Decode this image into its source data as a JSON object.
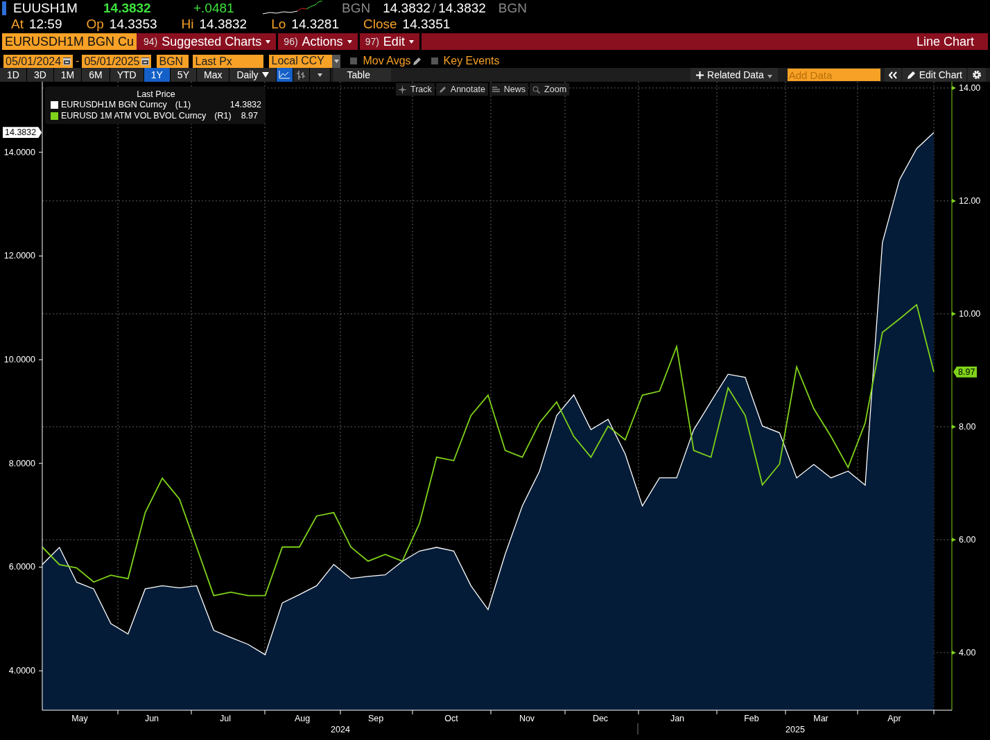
{
  "quote": {
    "ticker": "EUUSH1M",
    "last": "14.3832",
    "change": "+.0481",
    "source": "BGN",
    "bid": "14.3832",
    "separator": "/",
    "ask": "14.3832",
    "source_2": "BGN"
  },
  "stats": [
    {
      "label": "At",
      "value": "12:59"
    },
    {
      "label": "Op",
      "value": "14.3353"
    },
    {
      "label": "Hi",
      "value": "14.3832"
    },
    {
      "label": "Lo",
      "value": "14.3281"
    },
    {
      "label": "Close",
      "value": "14.3351"
    }
  ],
  "menu_bar": {
    "security": "EURUSDH1M BGN Cu",
    "items": [
      {
        "number": "94)",
        "label": "Suggested Charts"
      },
      {
        "number": "96)",
        "label": "Actions"
      },
      {
        "number": "97)",
        "label": "Edit"
      }
    ],
    "chart_type": "Line Chart"
  },
  "settings": {
    "start_date": "05/01/2024",
    "separator": "-",
    "end_date": "05/01/2025",
    "source": "BGN",
    "field": "Last Px",
    "currency": "Local CCY",
    "checkboxes": [
      {
        "label": "Mov Avgs",
        "checked": false,
        "kind": "editable"
      },
      {
        "label": "Key Events",
        "checked": false,
        "kind": "plain"
      }
    ]
  },
  "toolbar": {
    "periods": [
      {
        "label": "1D",
        "selected": false
      },
      {
        "label": "3D",
        "selected": false
      },
      {
        "label": "1M",
        "selected": false
      },
      {
        "label": "6M",
        "selected": false
      },
      {
        "label": "YTD",
        "selected": false
      },
      {
        "label": "1Y",
        "selected": true
      },
      {
        "label": "5Y",
        "selected": false
      },
      {
        "label": "Max",
        "selected": false
      }
    ],
    "frequency": "Daily",
    "view_buttons": [
      {
        "kind": "line",
        "selected": true
      },
      {
        "kind": "bar",
        "selected": false
      }
    ],
    "table": "Table",
    "related_data": "Related Data",
    "add_data_placeholder": "Add Data",
    "edit_chart": "Edit Chart"
  },
  "chart_tools": [
    {
      "kind": "track",
      "label": "Track"
    },
    {
      "kind": "annotate",
      "label": "Annotate"
    },
    {
      "kind": "news",
      "label": "News"
    },
    {
      "kind": "zoom",
      "label": "Zoom"
    }
  ],
  "legend": {
    "title": "Last Price",
    "items": [
      {
        "axis": "(L1)",
        "value": "14.3832"
      },
      {
        "axis": "(R1)",
        "value": "8.97"
      }
    ]
  },
  "chart": {
    "left_tag": "14.3832",
    "right_tag": "8.97",
    "month_labels": [
      "May",
      "Jun",
      "Jul",
      "Aug",
      "Sep",
      "Oct",
      "Nov",
      "Dec",
      "Jan",
      "Feb",
      "Mar",
      "Apr"
    ],
    "years": [
      "2024",
      "2025"
    ],
    "chart_data": {
      "type": "area",
      "grid": true,
      "ylim": [
        3.24,
        15.36
      ],
      "y2lim": [
        2.98,
        14.11
      ],
      "y2ticks": [
        {
          "value": 4,
          "label": "4.00"
        },
        {
          "value": 6,
          "label": "6.00"
        },
        {
          "value": 8,
          "label": "8.00"
        },
        {
          "value": 10,
          "label": "10.00"
        },
        {
          "value": 12,
          "label": "12.00"
        },
        {
          "value": 14,
          "label": "14.00"
        }
      ],
      "yticks": [
        {
          "value": 4,
          "label": "4.0000"
        },
        {
          "value": 6,
          "label": "6.0000"
        },
        {
          "value": 8,
          "label": "8.0000"
        },
        {
          "value": 10,
          "label": "10.0000"
        },
        {
          "value": 12,
          "label": "12.0000"
        },
        {
          "value": 14,
          "label": "14.0000"
        }
      ],
      "series": [
        {
          "name": "EURUSDH1M BGN Curncy",
          "color": "#ffffff",
          "values": [
            6.05,
            6.38,
            5.71,
            5.58,
            4.91,
            4.71,
            5.58,
            5.64,
            5.6,
            5.64,
            4.78,
            4.64,
            4.51,
            4.31,
            5.31,
            5.47,
            5.64,
            6.05,
            5.78,
            5.82,
            5.85,
            6.11,
            6.31,
            6.38,
            6.31,
            5.64,
            5.18,
            6.25,
            7.18,
            7.85,
            8.92,
            9.32,
            8.65,
            8.85,
            8.18,
            7.18,
            7.72,
            7.72,
            8.65,
            9.19,
            9.72,
            9.66,
            8.72,
            8.59,
            7.72,
            7.98,
            7.72,
            7.85,
            7.58,
            12.26,
            13.47,
            14.07,
            14.38
          ]
        },
        {
          "name": "EURUSD 1M ATM VOL BVOL Curncy",
          "color": "#7fd21a",
          "axis": "y2",
          "type": "line",
          "values": [
            5.87,
            5.56,
            5.5,
            5.25,
            5.37,
            5.31,
            6.48,
            7.09,
            6.72,
            5.87,
            5.01,
            5.07,
            5.01,
            5.01,
            5.87,
            5.87,
            6.42,
            6.48,
            5.87,
            5.62,
            5.74,
            5.62,
            6.29,
            7.46,
            7.4,
            8.2,
            8.56,
            7.58,
            7.46,
            8.07,
            8.44,
            7.83,
            7.46,
            8.01,
            7.77,
            8.56,
            8.63,
            9.42,
            7.58,
            7.46,
            8.69,
            8.2,
            6.97,
            7.34,
            9.06,
            8.32,
            7.83,
            7.28,
            8.07,
            9.67,
            9.91,
            10.16,
            8.97
          ]
        }
      ]
    }
  }
}
